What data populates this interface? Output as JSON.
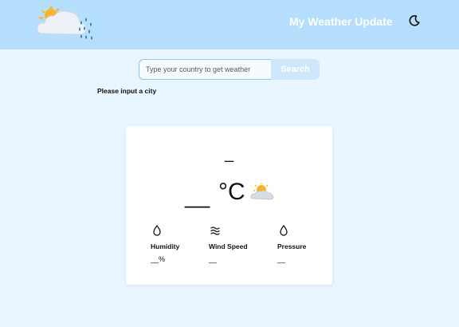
{
  "header": {
    "title": "My Weather Update",
    "logo_icon": "weather-logo-icon",
    "theme_toggle_icon": "moon-icon"
  },
  "search": {
    "placeholder": "Type your country to get weather",
    "button_label": "Search"
  },
  "message": "Please input a city",
  "card": {
    "city": "_",
    "temperature": "__",
    "unit": "°C",
    "condition_icon": "partly-cloudy-icon",
    "stats": {
      "humidity": {
        "label": "Humidity",
        "value": "__%",
        "icon": "droplet-icon"
      },
      "wind": {
        "label": "Wind Speed",
        "value": "__",
        "icon": "wind-icon"
      },
      "pressure": {
        "label": "Pressure",
        "value": "__",
        "icon": "droplet-icon"
      }
    }
  },
  "colors": {
    "header_bg": "#b6defd",
    "page_bg": "#e9f5ff",
    "button_bg": "#cde8fd",
    "input_border": "#90c8f5"
  }
}
